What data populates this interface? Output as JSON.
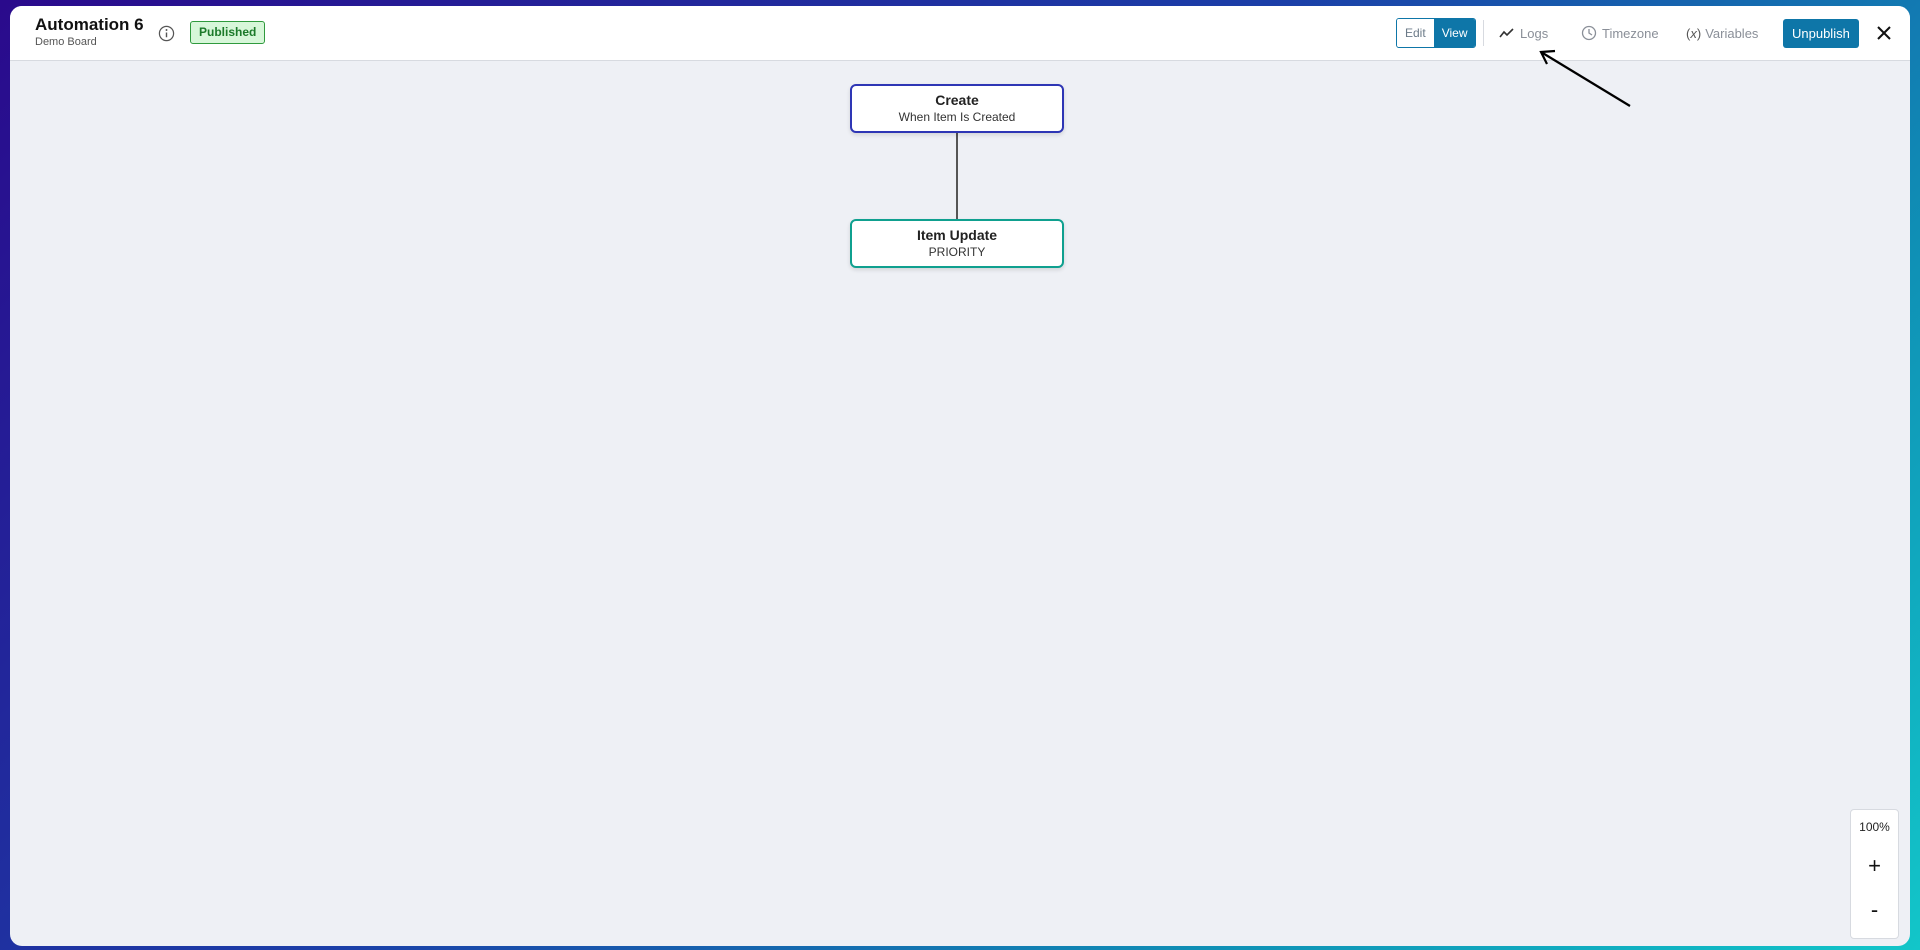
{
  "header": {
    "title": "Automation 6",
    "subtitle": "Demo Board",
    "status_badge": "Published",
    "mode_toggle": {
      "edit": "Edit",
      "view": "View",
      "active": "View"
    },
    "tools": {
      "logs": "Logs",
      "timezone": "Timezone",
      "variables": "Variables"
    },
    "unpublish": "Unpublish",
    "icons": [
      "info-icon",
      "logs-chart-icon",
      "timezone-clock-icon",
      "variables-icon",
      "close-icon"
    ]
  },
  "canvas": {
    "nodes": [
      {
        "title": "Create",
        "subtitle": "When Item Is Created",
        "border_color": "#2e36b5"
      },
      {
        "title": "Item Update",
        "subtitle": "PRIORITY",
        "border_color": "#0fa08f"
      }
    ]
  },
  "zoom": {
    "level": "100%",
    "in": "+",
    "out": "-"
  },
  "colors": {
    "accent": "#0e76a8",
    "badge_bg": "#d7f7d9",
    "badge_border": "#2f9a3d"
  }
}
